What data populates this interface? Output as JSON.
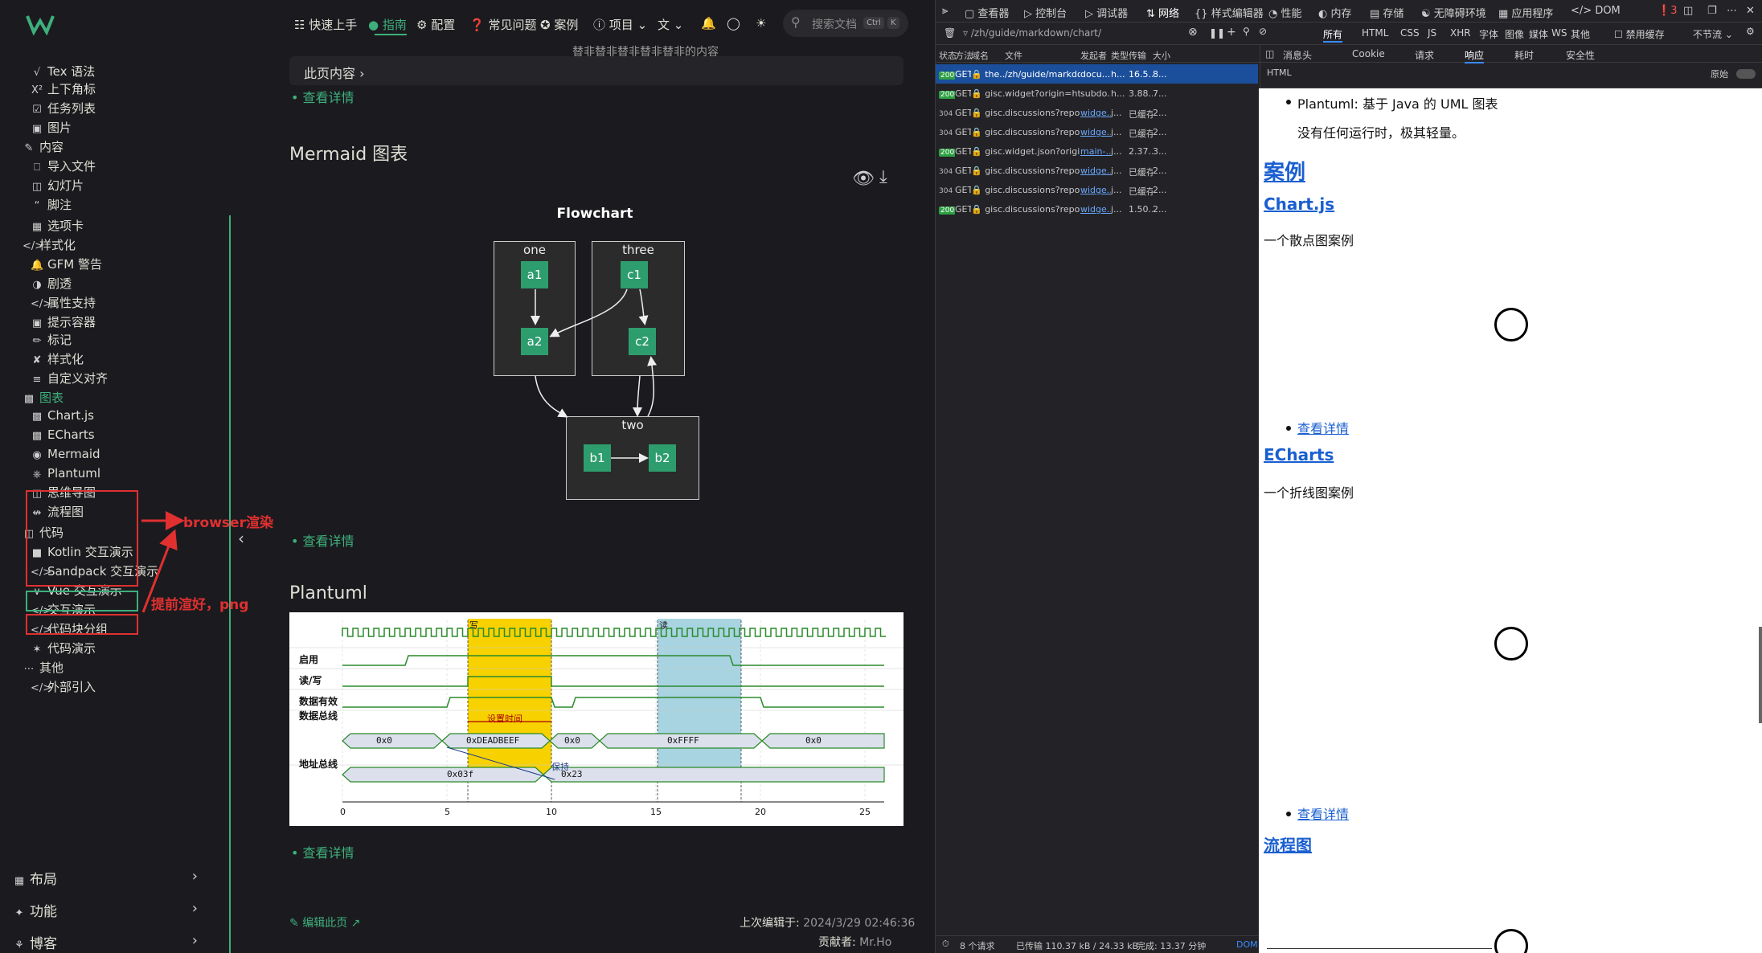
{
  "nav": {
    "items": [
      "快速上手",
      "指南",
      "配置",
      "常见问题",
      "案例",
      "项目"
    ],
    "search_placeholder": "搜索文档",
    "kbd_ctrl": "Ctrl",
    "kbd_k": "K"
  },
  "sidebar": {
    "items": [
      {
        "label": "Tex 语法",
        "icon": "tex-icon"
      },
      {
        "label": "上下角标",
        "icon": "superscript-icon"
      },
      {
        "label": "任务列表",
        "icon": "checkbox-icon"
      },
      {
        "label": "图片",
        "icon": "image-icon"
      },
      {
        "label": "内容",
        "icon": "pen-icon"
      },
      {
        "label": "导入文件",
        "icon": "import-icon"
      },
      {
        "label": "幻灯片",
        "icon": "slides-icon"
      },
      {
        "label": "脚注",
        "icon": "quote-icon"
      },
      {
        "label": "选项卡",
        "icon": "tabs-icon"
      },
      {
        "label": "样式化",
        "icon": "code-icon"
      },
      {
        "label": "GFM 警告",
        "icon": "bell-icon"
      },
      {
        "label": "剧透",
        "icon": "eye-icon"
      },
      {
        "label": "属性支持",
        "icon": "code-icon"
      },
      {
        "label": "提示容器",
        "icon": "container-icon"
      },
      {
        "label": "标记",
        "icon": "highlighter-icon"
      },
      {
        "label": "样式化",
        "icon": "brush-icon"
      },
      {
        "label": "自定义对齐",
        "icon": "align-icon"
      },
      {
        "label": "图表",
        "icon": "chart-icon"
      },
      {
        "label": "Chart.js",
        "icon": "chart-icon"
      },
      {
        "label": "ECharts",
        "icon": "chart-icon"
      },
      {
        "label": "Mermaid",
        "icon": "mermaid-icon"
      },
      {
        "label": "Plantuml",
        "icon": "diagram-icon"
      },
      {
        "label": "思维导图",
        "icon": "mindmap-icon"
      },
      {
        "label": "流程图",
        "icon": "flow-icon"
      },
      {
        "label": "代码",
        "icon": "code-block-icon"
      },
      {
        "label": "Kotlin 交互演示",
        "icon": "kotlin-icon"
      },
      {
        "label": "Sandpack 交互演示",
        "icon": "code-icon"
      },
      {
        "label": "Vue 交互演示",
        "icon": "vue-icon"
      },
      {
        "label": "交互演示",
        "icon": "code-icon"
      },
      {
        "label": "代码块分组",
        "icon": "code-icon"
      },
      {
        "label": "代码演示",
        "icon": "gear-icon"
      },
      {
        "label": "其他",
        "icon": "dots-icon"
      },
      {
        "label": "外部引入",
        "icon": "code-icon"
      }
    ],
    "groups": [
      {
        "label": "布局",
        "icon": "layout-icon"
      },
      {
        "label": "功能",
        "icon": "puzzle-icon"
      },
      {
        "label": "博客",
        "icon": "blog-icon"
      }
    ],
    "annotation_browser": "browser渲染",
    "annotation_png": "提前渲好，png"
  },
  "main": {
    "truncated_text": "替非替非替非替非替非的内容",
    "toc": "此页内容",
    "detail_link": "查看详情",
    "mermaid_heading": "Mermaid 图表",
    "flowchart_title": "Flowchart",
    "flowchart": {
      "groups": [
        "one",
        "three",
        "two"
      ],
      "nodes": [
        "a1",
        "a2",
        "c1",
        "c2",
        "b1",
        "b2"
      ]
    },
    "plantuml_heading": "Plantuml",
    "plantuml": {
      "section_write": "写",
      "section_read": "读",
      "signals": [
        "启用",
        "读/写",
        "数据有效",
        "数据总线",
        "地址总线"
      ],
      "setup_label": "设置时间",
      "hold_label": "保持",
      "data_bus": [
        "0x0",
        "0xDEADBEEF",
        "0x0",
        "0xFFFF",
        "0x0"
      ],
      "addr_bus": [
        "0x03f",
        "0x23"
      ],
      "ticks": [
        "0",
        "5",
        "10",
        "15",
        "20",
        "25"
      ]
    },
    "edit_link": "编辑此页",
    "last_updated_label": "上次编辑于:",
    "last_updated": "2024/3/29 02:46:36",
    "contributors_label": "贡献者:",
    "contributors": "Mr.Ho"
  },
  "devtools": {
    "tabs": [
      "查看器",
      "控制台",
      "调试器",
      "网络",
      "样式编辑器",
      "性能",
      "内存",
      "存储",
      "无障碍环境",
      "应用程序",
      "DOM"
    ],
    "error_count": "3",
    "url_filter": "/zh/guide/markdown/chart/",
    "filters": [
      "所有",
      "HTML",
      "CSS",
      "JS",
      "XHR",
      "字体",
      "图像",
      "媒体",
      "WS",
      "其他"
    ],
    "disable_cache": "禁用缓存",
    "throttle": "不节流",
    "columns": [
      "状态",
      "方法",
      "域名",
      "文件",
      "发起者",
      "类型",
      "传输",
      "大小"
    ],
    "requests": [
      {
        "status": "200",
        "method": "GET",
        "domain": "the...",
        "file": "/zh/guide/markdown/ch",
        "initiator": "docu...",
        "type": "h...",
        "transfer": "16.5...",
        "size": "8..."
      },
      {
        "status": "200",
        "method": "GET",
        "domain": "gisc...",
        "file": "widget?origin=https://th",
        "initiator": "subdo...",
        "type": "h...",
        "transfer": "3.88...",
        "size": "7..."
      },
      {
        "status": "304",
        "method": "GET",
        "domain": "gisc...",
        "file": "discussions?repo=vu",
        "initiator": "widge...",
        "type": "j...",
        "transfer": "已缓存",
        "size": "2..."
      },
      {
        "status": "304",
        "method": "GET",
        "domain": "gisc...",
        "file": "discussions?repo=vu",
        "initiator": "widge...",
        "type": "j...",
        "transfer": "已缓存",
        "size": "2..."
      },
      {
        "status": "200",
        "method": "GET",
        "domain": "gisc...",
        "file": "widget.json?origin=http",
        "initiator": "main-...",
        "type": "j...",
        "transfer": "2.37...",
        "size": "3..."
      },
      {
        "status": "304",
        "method": "GET",
        "domain": "gisc...",
        "file": "discussions?repo=vu",
        "initiator": "widge...",
        "type": "j...",
        "transfer": "已缓存",
        "size": "2..."
      },
      {
        "status": "304",
        "method": "GET",
        "domain": "gisc...",
        "file": "discussions?repo=vuepr",
        "initiator": "widge...",
        "type": "j...",
        "transfer": "已缓存",
        "size": "2..."
      },
      {
        "status": "200",
        "method": "GET",
        "domain": "gisc...",
        "file": "discussions?repo=vuepr",
        "initiator": "widge...",
        "type": "j...",
        "transfer": "1.50...",
        "size": "2..."
      }
    ],
    "response_tabs": [
      "消息头",
      "Cookie",
      "请求",
      "响应",
      "耗时",
      "安全性"
    ],
    "resp_type": "HTML",
    "raw_label": "原始",
    "status": {
      "count": "8 个请求",
      "transferred": "已传输 110.37 kB / 24.33 kB",
      "finish": "完成: 13.37 分钟",
      "dom": "DOM"
    },
    "response": {
      "plantuml_item": "Plantuml: 基于 Java 的 UML 图表",
      "no_runtime": "没有任何运行时，极其轻量。",
      "cases": "案例",
      "chartjs": "Chart.js",
      "chartjs_desc": "一个散点图案例",
      "detail": "查看详情",
      "echarts": "ECharts",
      "echarts_desc": "一个折线图案例",
      "flowchart": "流程图"
    }
  }
}
